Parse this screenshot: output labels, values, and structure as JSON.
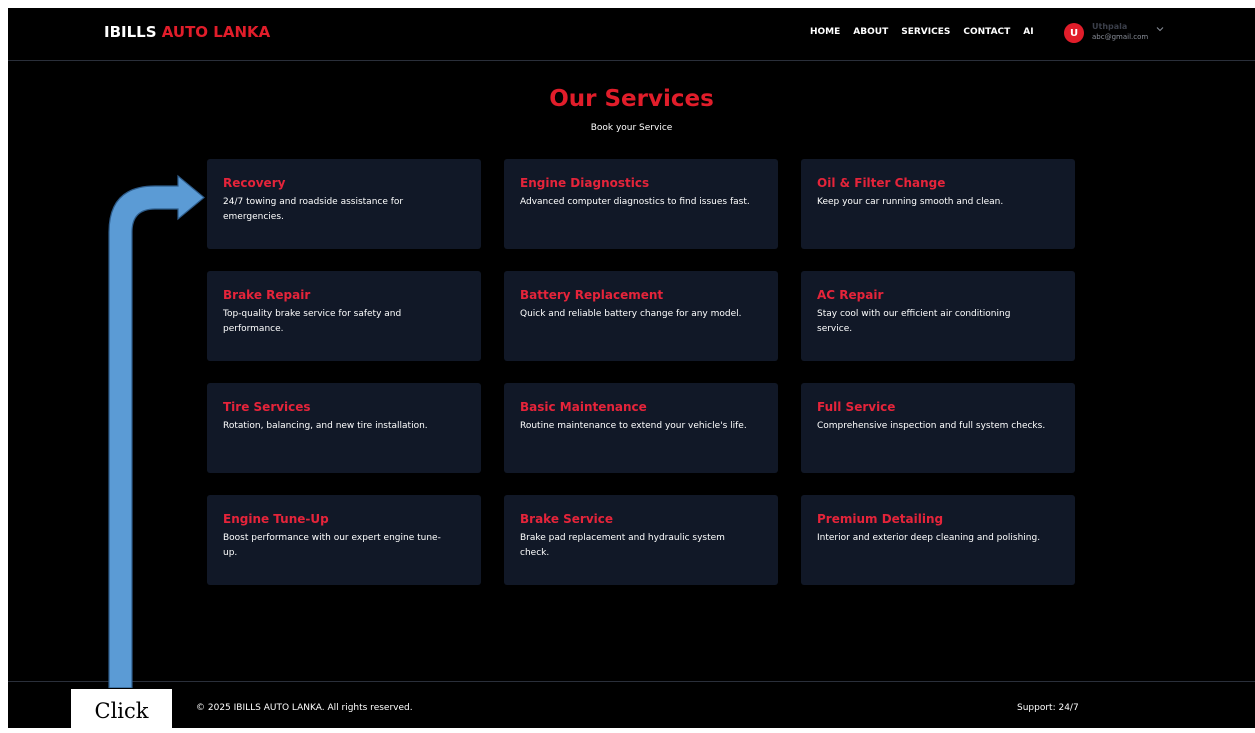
{
  "navbar": {
    "brand_part1": "IBILLS",
    "brand_part2": "AUTO LANKA",
    "links": [
      "HOME",
      "ABOUT",
      "SERVICES",
      "CONTACT",
      "AI"
    ],
    "user": {
      "avatar_letter": "U",
      "name": "Uthpala",
      "email": "abc@gmail.com"
    }
  },
  "header": {
    "title": "Our Services",
    "subtitle": "Book your Service"
  },
  "services": [
    {
      "title": "Recovery",
      "desc": "24/7 towing and roadside assistance for emergencies."
    },
    {
      "title": "Engine Diagnostics",
      "desc": "Advanced computer diagnostics to find issues fast."
    },
    {
      "title": "Oil & Filter Change",
      "desc": "Keep your car running smooth and clean."
    },
    {
      "title": "Brake Repair",
      "desc": "Top-quality brake service for safety and performance."
    },
    {
      "title": "Battery Replacement",
      "desc": "Quick and reliable battery change for any model."
    },
    {
      "title": "AC Repair",
      "desc": "Stay cool with our efficient air conditioning service."
    },
    {
      "title": "Tire Services",
      "desc": "Rotation, balancing, and new tire installation."
    },
    {
      "title": "Basic Maintenance",
      "desc": "Routine maintenance to extend your vehicle's life."
    },
    {
      "title": "Full Service",
      "desc": "Comprehensive inspection and full system checks."
    },
    {
      "title": "Engine Tune-Up",
      "desc": "Boost performance with our expert engine tune-up."
    },
    {
      "title": "Brake Service",
      "desc": "Brake pad replacement and hydraulic system check."
    },
    {
      "title": "Premium Detailing",
      "desc": "Interior and exterior deep cleaning and polishing."
    }
  ],
  "footer": {
    "copyright": "© 2025 IBILLS AUTO LANKA. All rights reserved.",
    "support": "Support: 24/7"
  },
  "annotation": {
    "label": "Click"
  },
  "colors": {
    "accent": "#e11d2a",
    "card_bg": "#111827",
    "page_bg": "#000000",
    "annotation_arrow": "#5b9bd5"
  },
  "icons": {
    "user_menu": "chevron-down-icon",
    "annotation": "arrow-icon"
  }
}
